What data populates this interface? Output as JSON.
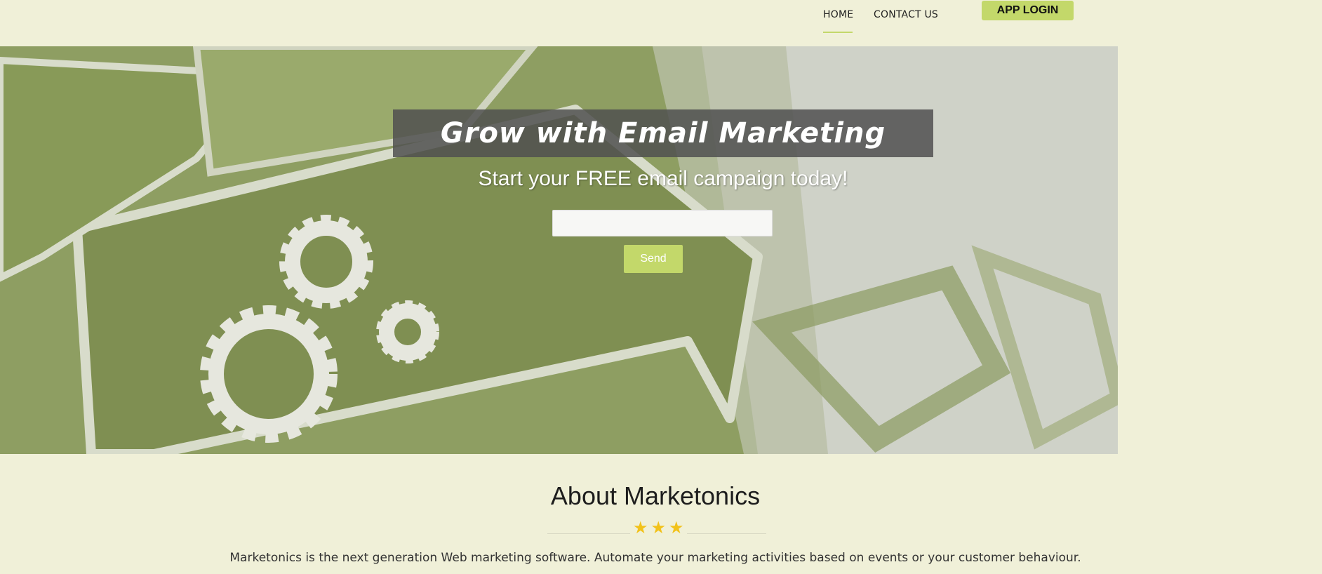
{
  "nav": {
    "home": "HOME",
    "contact": "CONTACT US",
    "login": "APP LOGIN"
  },
  "hero": {
    "title": "Grow with Email Marketing",
    "subtitle": "Start your FREE email campaign today!",
    "input_value": "",
    "send_label": "Send"
  },
  "about": {
    "title": "About Marketonics",
    "stars": [
      "★",
      "★",
      "★"
    ],
    "text": "Marketonics is the next generation Web marketing software. Automate your marketing activities based on events or your customer behaviour."
  },
  "colors": {
    "accent": "#c3d86a",
    "background": "#f0f0d8",
    "hero_green": "#8a9a5e",
    "star": "#f2c21a"
  }
}
